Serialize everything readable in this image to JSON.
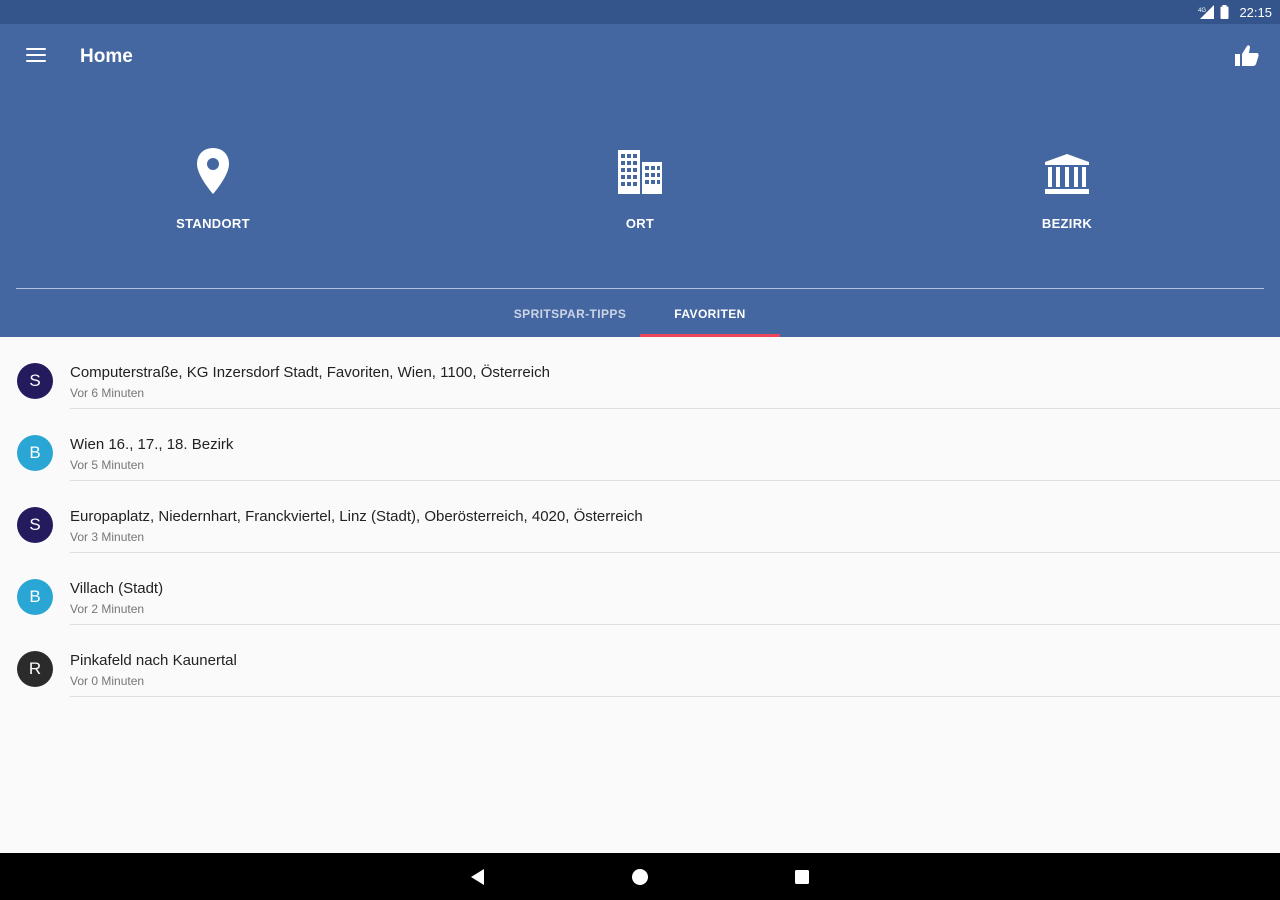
{
  "status_bar": {
    "time": "22:15",
    "network": "4G"
  },
  "toolbar": {
    "title": "Home"
  },
  "quick_actions": [
    {
      "label": "STANDORT",
      "icon": "location-pin-icon"
    },
    {
      "label": "ORT",
      "icon": "buildings-icon"
    },
    {
      "label": "BEZIRK",
      "icon": "institution-icon"
    }
  ],
  "tabs": [
    {
      "label": "SPRITSPAR-TIPPS",
      "active": false
    },
    {
      "label": "FAVORITEN",
      "active": true
    }
  ],
  "colors": {
    "status_bar": "#33558b",
    "app_bar": "#4467a1",
    "tab_indicator": "#e9475b",
    "avatar_s": "#241a5e",
    "avatar_b": "#2aa6d4",
    "avatar_r": "#2b2b2b"
  },
  "favorites": [
    {
      "letter": "S",
      "title": "Computerstraße, KG Inzersdorf Stadt, Favoriten, Wien, 1100, Österreich",
      "subtitle": "Vor 6 Minuten",
      "color": "#241a5e"
    },
    {
      "letter": "B",
      "title": "Wien 16., 17., 18. Bezirk",
      "subtitle": "Vor 5 Minuten",
      "color": "#2aa6d4"
    },
    {
      "letter": "S",
      "title": "Europaplatz, Niedernhart, Franckviertel, Linz (Stadt), Oberösterreich, 4020, Österreich",
      "subtitle": "Vor 3 Minuten",
      "color": "#241a5e"
    },
    {
      "letter": "B",
      "title": "Villach (Stadt)",
      "subtitle": "Vor 2 Minuten",
      "color": "#2aa6d4"
    },
    {
      "letter": "R",
      "title": "Pinkafeld nach Kaunertal",
      "subtitle": "Vor 0 Minuten",
      "color": "#2b2b2b"
    }
  ]
}
